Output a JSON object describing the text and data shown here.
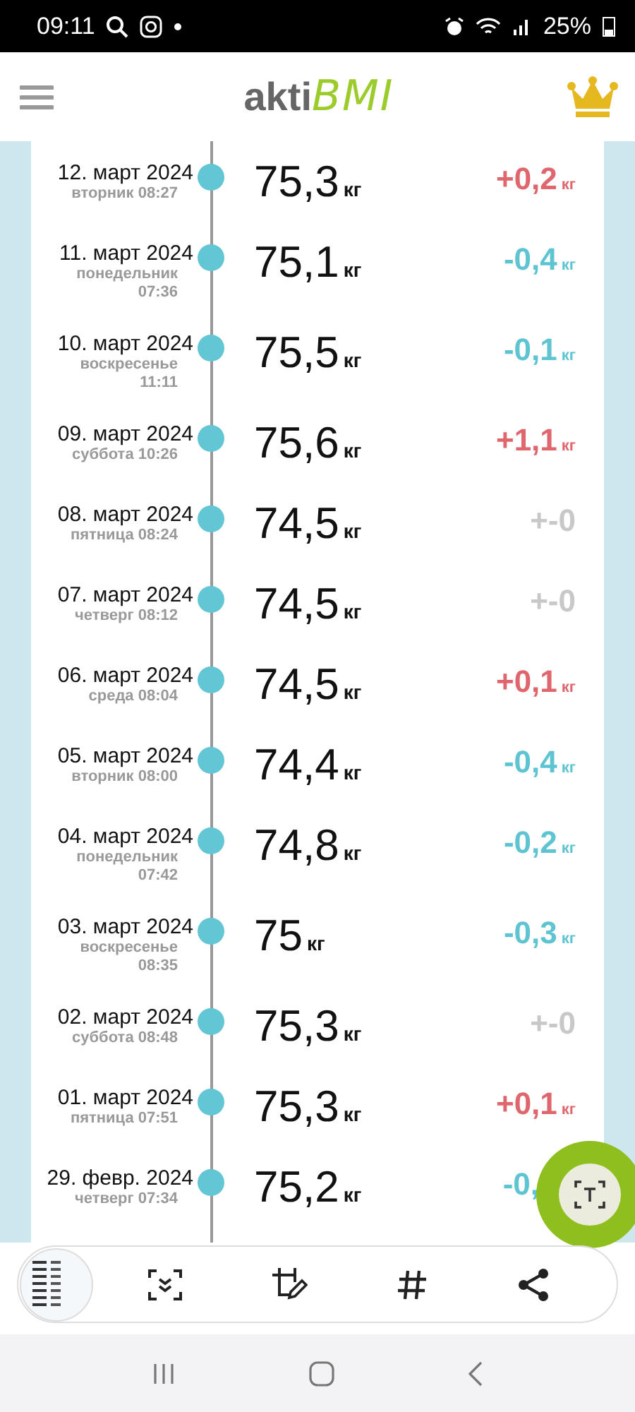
{
  "status_bar": {
    "time": "09:11",
    "battery": "25%"
  },
  "header": {
    "logo_main": "akti",
    "logo_accent": "BMI"
  },
  "entries": [
    {
      "date": "12. март 2024",
      "subtitle": "вторник 08:27",
      "weight": "75,3",
      "unit": "кг",
      "delta": "+0,2",
      "delta_unit": "кг",
      "kind": "gain"
    },
    {
      "date": "11. март 2024",
      "subtitle": "понедельник 07:36",
      "weight": "75,1",
      "unit": "кг",
      "delta": "-0,4",
      "delta_unit": "кг",
      "kind": "loss"
    },
    {
      "date": "10. март 2024",
      "subtitle": "воскресенье 11:11",
      "weight": "75,5",
      "unit": "кг",
      "delta": "-0,1",
      "delta_unit": "кг",
      "kind": "loss"
    },
    {
      "date": "09. март 2024",
      "subtitle": "суббота 10:26",
      "weight": "75,6",
      "unit": "кг",
      "delta": "+1,1",
      "delta_unit": "кг",
      "kind": "gain"
    },
    {
      "date": "08. март 2024",
      "subtitle": "пятница 08:24",
      "weight": "74,5",
      "unit": "кг",
      "delta": "+-0",
      "kind": "same"
    },
    {
      "date": "07. март 2024",
      "subtitle": "четверг 08:12",
      "weight": "74,5",
      "unit": "кг",
      "delta": "+-0",
      "kind": "same"
    },
    {
      "date": "06. март 2024",
      "subtitle": "среда 08:04",
      "weight": "74,5",
      "unit": "кг",
      "delta": "+0,1",
      "delta_unit": "кг",
      "kind": "gain"
    },
    {
      "date": "05. март 2024",
      "subtitle": "вторник 08:00",
      "weight": "74,4",
      "unit": "кг",
      "delta": "-0,4",
      "delta_unit": "кг",
      "kind": "loss"
    },
    {
      "date": "04. март 2024",
      "subtitle": "понедельник 07:42",
      "weight": "74,8",
      "unit": "кг",
      "delta": "-0,2",
      "delta_unit": "кг",
      "kind": "loss"
    },
    {
      "date": "03. март 2024",
      "subtitle": "воскресенье 08:35",
      "weight": "75",
      "unit": "кг",
      "delta": "-0,3",
      "delta_unit": "кг",
      "kind": "loss"
    },
    {
      "date": "02. март 2024",
      "subtitle": "суббота 08:48",
      "weight": "75,3",
      "unit": "кг",
      "delta": "+-0",
      "kind": "same"
    },
    {
      "date": "01. март 2024",
      "subtitle": "пятница 07:51",
      "weight": "75,3",
      "unit": "кг",
      "delta": "+0,1",
      "delta_unit": "кг",
      "kind": "gain"
    },
    {
      "date": "29. февр. 2024",
      "subtitle": "четверг 07:34",
      "weight": "75,2",
      "unit": "кг",
      "delta": "-0,",
      "kind": "loss"
    }
  ]
}
